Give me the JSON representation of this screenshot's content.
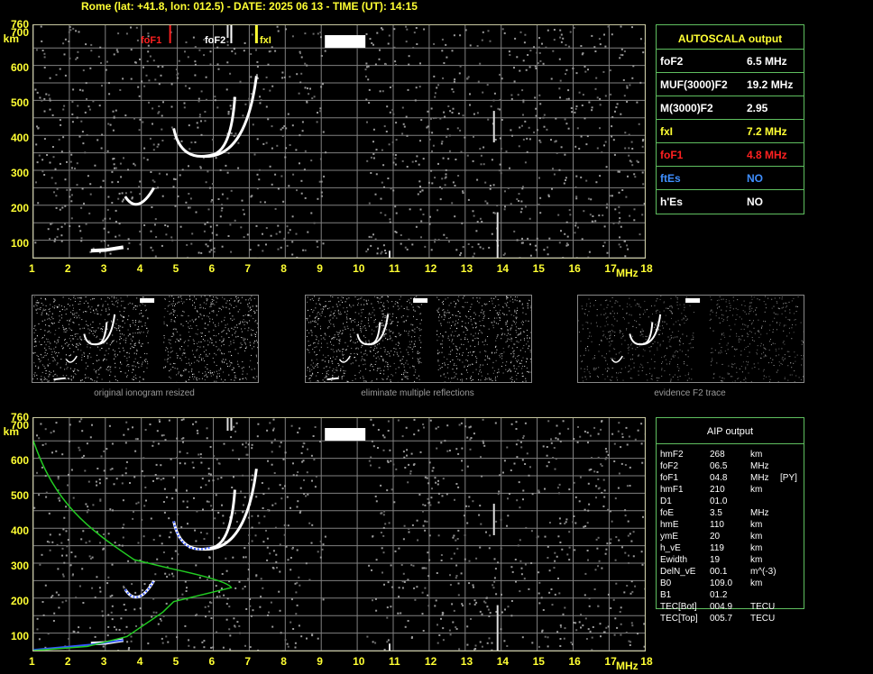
{
  "header": "Rome (lat: +41.8, lon: 012.5) - DATE: 2025 06 13 - TIME (UT): 14:15",
  "axis": {
    "y_ticks": [
      "760",
      "700",
      "600",
      "500",
      "400",
      "300",
      "200",
      "100"
    ],
    "y_unit": "km",
    "x_ticks": [
      "1",
      "2",
      "3",
      "4",
      "5",
      "6",
      "7",
      "8",
      "9",
      "10",
      "11",
      "12",
      "13",
      "14",
      "15",
      "16",
      "17",
      "18"
    ],
    "x_unit": "MHz"
  },
  "markers": {
    "foF1": "foF1",
    "foF2": "foF2",
    "fxI": "fxI"
  },
  "autoscala": {
    "title": "AUTOSCALA output",
    "rows": [
      {
        "key": "foF2",
        "value": "6.5 MHz",
        "color": "#ffffff"
      },
      {
        "key": "MUF(3000)F2",
        "value": "19.2 MHz",
        "color": "#ffffff"
      },
      {
        "key": "M(3000)F2",
        "value": "2.95",
        "color": "#ffffff"
      },
      {
        "key": "fxI",
        "value": "7.2 MHz",
        "color": "#ffff33"
      },
      {
        "key": "foF1",
        "value": "4.8 MHz",
        "color": "#ff2020"
      },
      {
        "key": "ftEs",
        "value": "NO",
        "color": "#3f8fff"
      },
      {
        "key": "h'Es",
        "value": "NO",
        "color": "#ffffff"
      }
    ]
  },
  "thumbnails": [
    {
      "caption": "original ionogram resized"
    },
    {
      "caption": "eliminate multiple reflections"
    },
    {
      "caption": "evidence F2 trace"
    }
  ],
  "aip": {
    "title": "AIP output",
    "rows": [
      {
        "k": "hmF2",
        "v": "268",
        "u": "km",
        "x": ""
      },
      {
        "k": "foF2",
        "v": "06.5",
        "u": "MHz",
        "x": ""
      },
      {
        "k": "foF1",
        "v": "04.8",
        "u": "MHz",
        "x": "[PY]"
      },
      {
        "k": "hmF1",
        "v": "210",
        "u": "km",
        "x": ""
      },
      {
        "k": "D1",
        "v": "01.0",
        "u": "",
        "x": ""
      },
      {
        "k": "foE",
        "v": "3.5",
        "u": "MHz",
        "x": ""
      },
      {
        "k": "hmE",
        "v": "110",
        "u": "km",
        "x": ""
      },
      {
        "k": "ymE",
        "v": "20",
        "u": "km",
        "x": ""
      },
      {
        "k": "h_vE",
        "v": "119",
        "u": "km",
        "x": ""
      },
      {
        "k": "Ewidth",
        "v": "19",
        "u": "km",
        "x": ""
      },
      {
        "k": "DelN_vE",
        "v": "00.1",
        "u": "m^(-3)",
        "x": ""
      },
      {
        "k": "B0",
        "v": "109.0",
        "u": "km",
        "x": ""
      },
      {
        "k": "B1",
        "v": "01.2",
        "u": "",
        "x": ""
      },
      {
        "k": "TEC[Bot]",
        "v": "004.9",
        "u": "TECU",
        "x": ""
      },
      {
        "k": "TEC[Top]",
        "v": "005.7",
        "u": "TECU",
        "x": ""
      }
    ]
  },
  "colors": {
    "axis_text": "#ffff33",
    "grid": "#808080",
    "trace": "#ffffff",
    "profile": "#22cc22",
    "aip_trace": "#3355ff"
  }
}
